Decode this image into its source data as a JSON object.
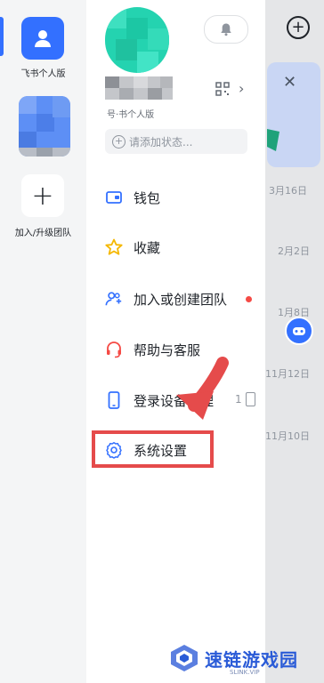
{
  "rail": {
    "personal_label": "飞书个人版",
    "add_label": "加入/升级团队"
  },
  "chat_list": {
    "dates": [
      "3月16日",
      "2月2日",
      "1月8日",
      "11月12日",
      "11月10日"
    ]
  },
  "profile": {
    "subtitle": "号·书个人版",
    "status_placeholder": "请添加状态..."
  },
  "menu": {
    "items": [
      {
        "label": "钱包",
        "icon": "wallet-icon"
      },
      {
        "label": "收藏",
        "icon": "star-icon"
      },
      {
        "label": "加入或创建团队",
        "icon": "add-team-icon"
      },
      {
        "label": "帮助与客服",
        "icon": "headset-icon"
      },
      {
        "label": "登录设备管理",
        "icon": "phone-icon"
      },
      {
        "label": "系统设置",
        "icon": "gear-icon"
      }
    ],
    "device_count": "1"
  },
  "colors": {
    "accent": "#3370ff",
    "highlight": "#e54b4b",
    "alert_dot": "#f54a45"
  },
  "watermark": {
    "title": "速链游戏园",
    "sub": "SLINK.VIP"
  }
}
